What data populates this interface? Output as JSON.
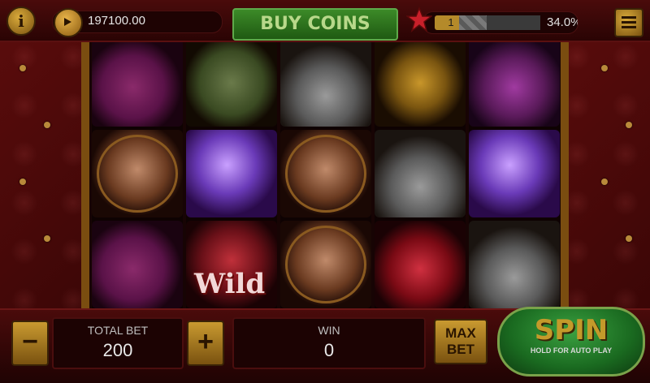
{
  "topbar": {
    "balance": "197100.00",
    "buy_label": "BUY COINS",
    "level": "1",
    "progress_percent": 34.0,
    "progress_label": "34.0%",
    "icons": [
      "info-icon",
      "coin-play-icon",
      "star-icon",
      "menu-icon"
    ]
  },
  "reels": [
    [
      {
        "symbol": "plum"
      },
      {
        "symbol": "girl"
      },
      {
        "symbol": "plum"
      }
    ],
    [
      {
        "symbol": "money"
      },
      {
        "symbol": "disco-ball"
      },
      {
        "symbol": "wild-lips",
        "text": "Wild"
      }
    ],
    [
      {
        "symbol": "champagne"
      },
      {
        "symbol": "girl"
      },
      {
        "symbol": "girl"
      }
    ],
    [
      {
        "symbol": "ring"
      },
      {
        "symbol": "champagne"
      },
      {
        "symbol": "cherry"
      }
    ],
    [
      {
        "symbol": "stage"
      },
      {
        "symbol": "disco-ball"
      },
      {
        "symbol": "champagne"
      }
    ]
  ],
  "bottombar": {
    "minus": "−",
    "total_bet_label": "TOTAL BET",
    "total_bet": "200",
    "plus": "+",
    "win_label": "WIN",
    "win": "0",
    "maxbet_line1": "MAX",
    "maxbet_line2": "BET",
    "spin_label": "SPIN",
    "spin_sub": "HOLD FOR AUTO PLAY"
  },
  "colors": {
    "accent_gold": "#c49a2a",
    "buy_green": "#1f5a12",
    "spin_green": "#1a6a20",
    "bg_red": "#3a0707"
  }
}
